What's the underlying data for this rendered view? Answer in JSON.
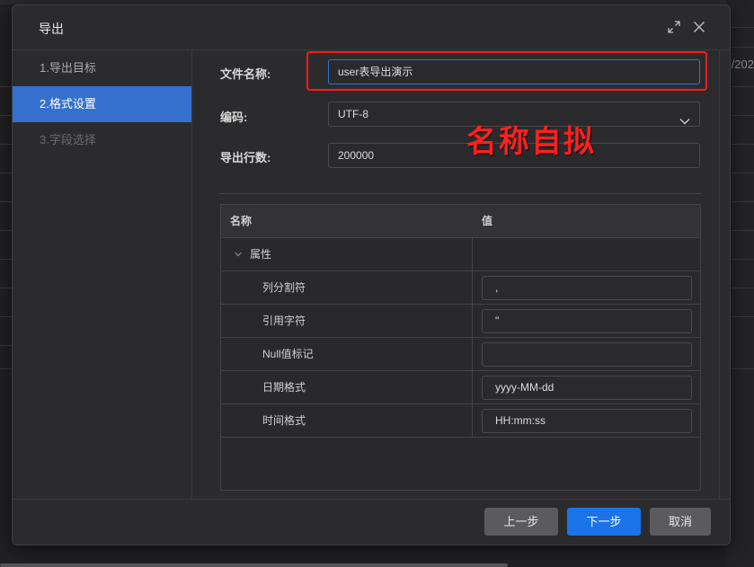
{
  "background": {
    "date_fragment": "/202"
  },
  "dialog": {
    "title": "导出",
    "icons": {
      "expand": "expand-icon",
      "close": "close-icon"
    },
    "steps": [
      {
        "label": "1.导出目标",
        "state": "done"
      },
      {
        "label": "2.格式设置",
        "state": "active"
      },
      {
        "label": "3.字段选择",
        "state": "pending"
      }
    ],
    "form": {
      "filename": {
        "label": "文件名称:",
        "value": "user表导出演示"
      },
      "encoding": {
        "label": "编码:",
        "value": "UTF-8"
      },
      "rows": {
        "label": "导出行数:",
        "value": "200000"
      }
    },
    "annotation": "名称自拟",
    "table": {
      "headers": {
        "name": "名称",
        "value": "值"
      },
      "group": "属性",
      "rows": [
        {
          "name": "列分割符",
          "value": ","
        },
        {
          "name": "引用字符",
          "value": "\""
        },
        {
          "name": "Null值标记",
          "value": ""
        },
        {
          "name": "日期格式",
          "value": "yyyy-MM-dd"
        },
        {
          "name": "时间格式",
          "value": "HH:mm:ss"
        }
      ]
    },
    "buttons": {
      "prev": "上一步",
      "next": "下一步",
      "cancel": "取消"
    }
  },
  "colors": {
    "accent": "#3570cf",
    "primary_button": "#1a73e8",
    "annotation": "#ff1a1a"
  }
}
